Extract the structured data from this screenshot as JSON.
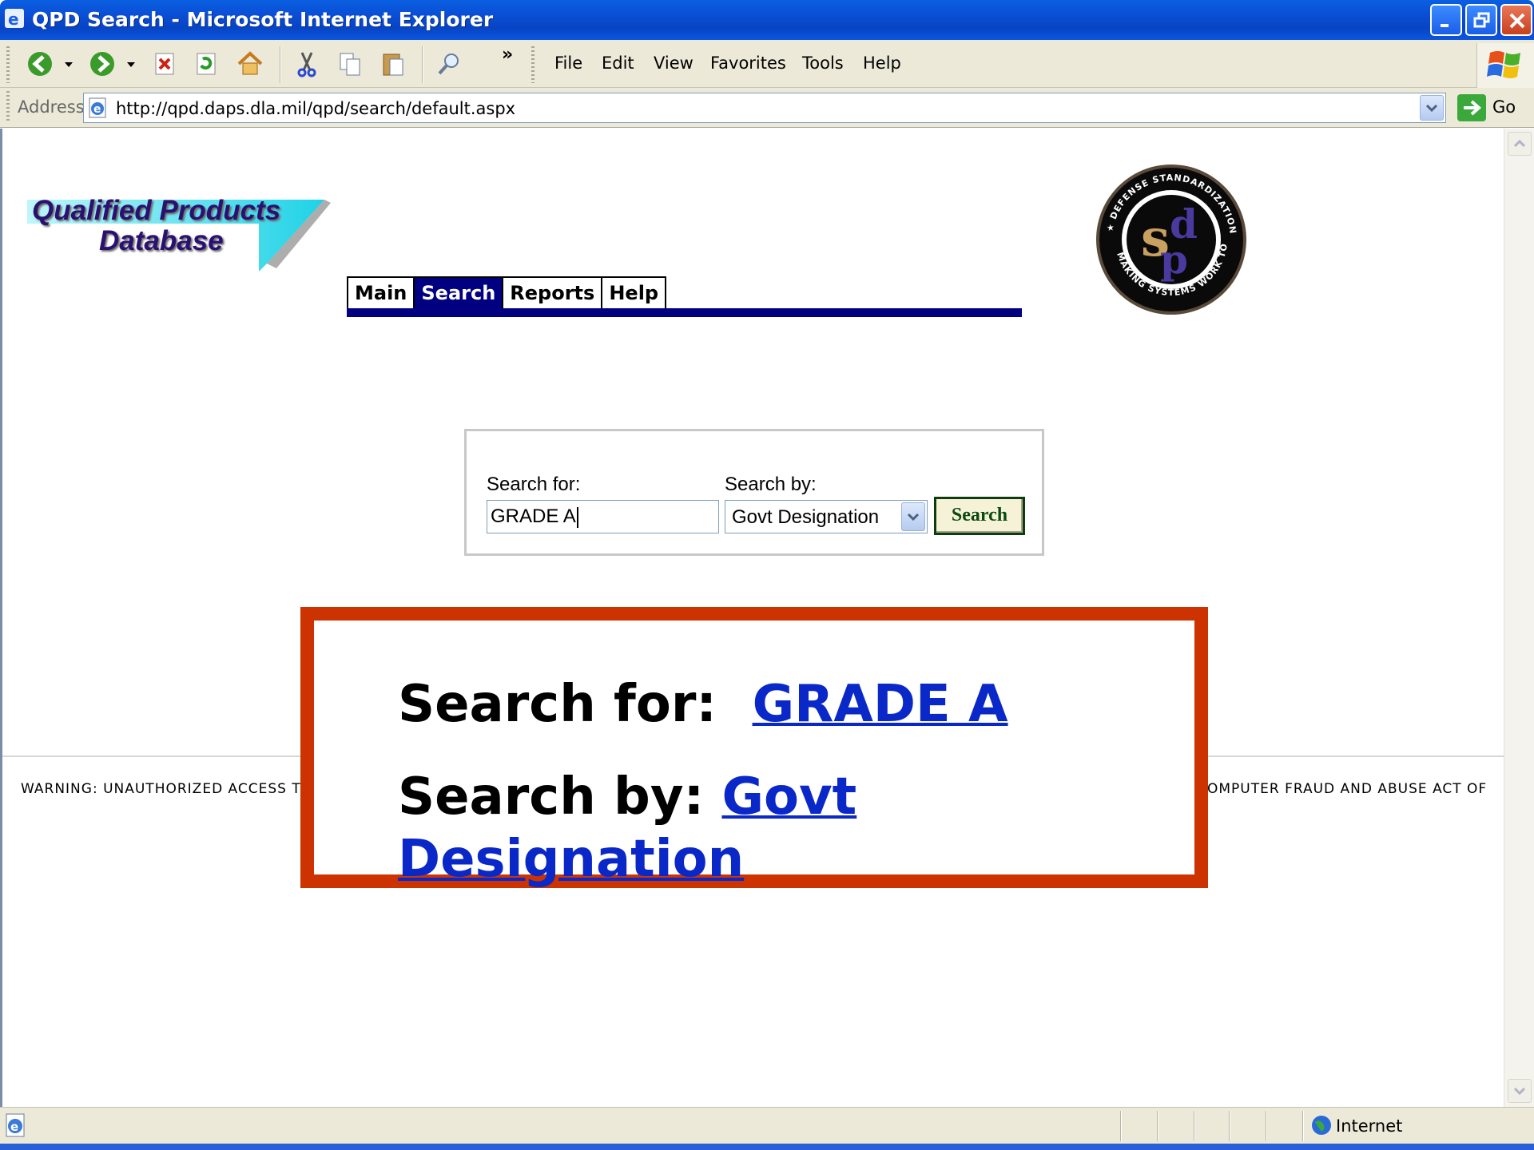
{
  "window": {
    "title": "QPD Search - Microsoft Internet Explorer"
  },
  "menu": {
    "items": [
      "File",
      "Edit",
      "View",
      "Favorites",
      "Tools",
      "Help"
    ],
    "more_chevron": "»"
  },
  "address_bar": {
    "label": "Address",
    "url": "http://qpd.daps.dla.mil/qpd/search/default.aspx",
    "go_label": "Go"
  },
  "site": {
    "logo_line1": "Qualified Products",
    "logo_line2": "Database",
    "seal_letters": "dsp",
    "seal_ring_text": "DEFENSE STANDARDIZATION PROGRAM ★ MAKING SYSTEMS WORK TOGETHER ★"
  },
  "nav": {
    "tabs": [
      {
        "label": "Main",
        "active": false
      },
      {
        "label": "Search",
        "active": true
      },
      {
        "label": "Reports",
        "active": false
      },
      {
        "label": "Help",
        "active": false
      }
    ]
  },
  "search_form": {
    "search_for_label": "Search for:",
    "search_for_value": "GRADE A",
    "search_by_label": "Search by:",
    "search_by_selected": "Govt Designation",
    "button_label": "Search"
  },
  "footer": {
    "warning_left": "WARNING: UNAUTHORIZED ACCESS T",
    "warning_right": "OMPUTER FRAUD AND ABUSE ACT OF"
  },
  "callout": {
    "line1_label": "Search for:",
    "line1_value": "GRADE A",
    "line2_label": "Search by:",
    "line2_value": "Govt Designation"
  },
  "status_bar": {
    "zone": "Internet"
  },
  "colors": {
    "nav_blue": "#000080",
    "callout_border": "#cc3300",
    "link_blue": "#0a28c8",
    "titlebar_blue": "#0a4fd6"
  }
}
